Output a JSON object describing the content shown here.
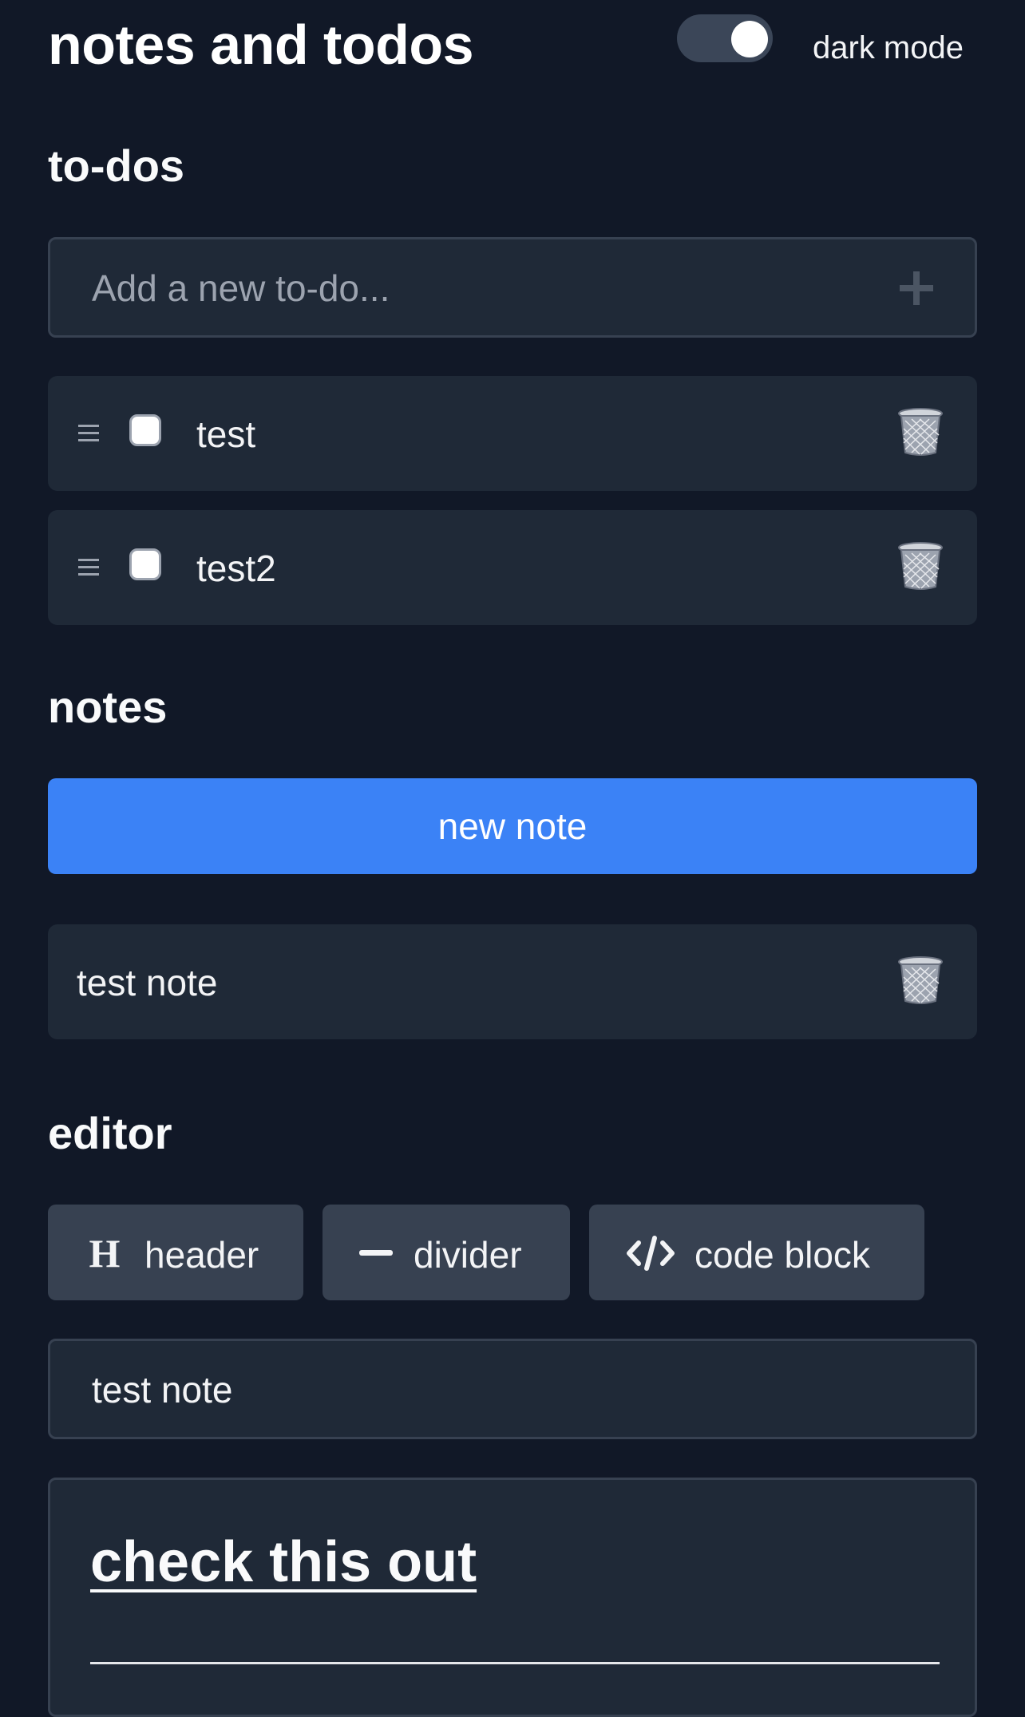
{
  "header": {
    "title": "notes and todos",
    "dark_mode_label": "dark mode",
    "dark_mode_on": true
  },
  "todos": {
    "section_title": "to-dos",
    "input_placeholder": "Add a new to-do...",
    "add_icon": "plus-icon",
    "items": [
      {
        "text": "test",
        "checked": false
      },
      {
        "text": "test2",
        "checked": false
      }
    ]
  },
  "notes": {
    "section_title": "notes",
    "new_note_label": "new note",
    "items": [
      {
        "title": "test note"
      }
    ]
  },
  "editor": {
    "section_title": "editor",
    "toolbar": {
      "header_label": "header",
      "divider_label": "divider",
      "code_block_label": "code block"
    },
    "title_value": "test note",
    "content_heading": "check this out"
  },
  "colors": {
    "background": "#111827",
    "card": "#1f2937",
    "border": "#374151",
    "toolbar_button": "#374151",
    "accent": "#3b82f6",
    "text": "#f3f4f6",
    "muted_text": "#9ca3af"
  }
}
